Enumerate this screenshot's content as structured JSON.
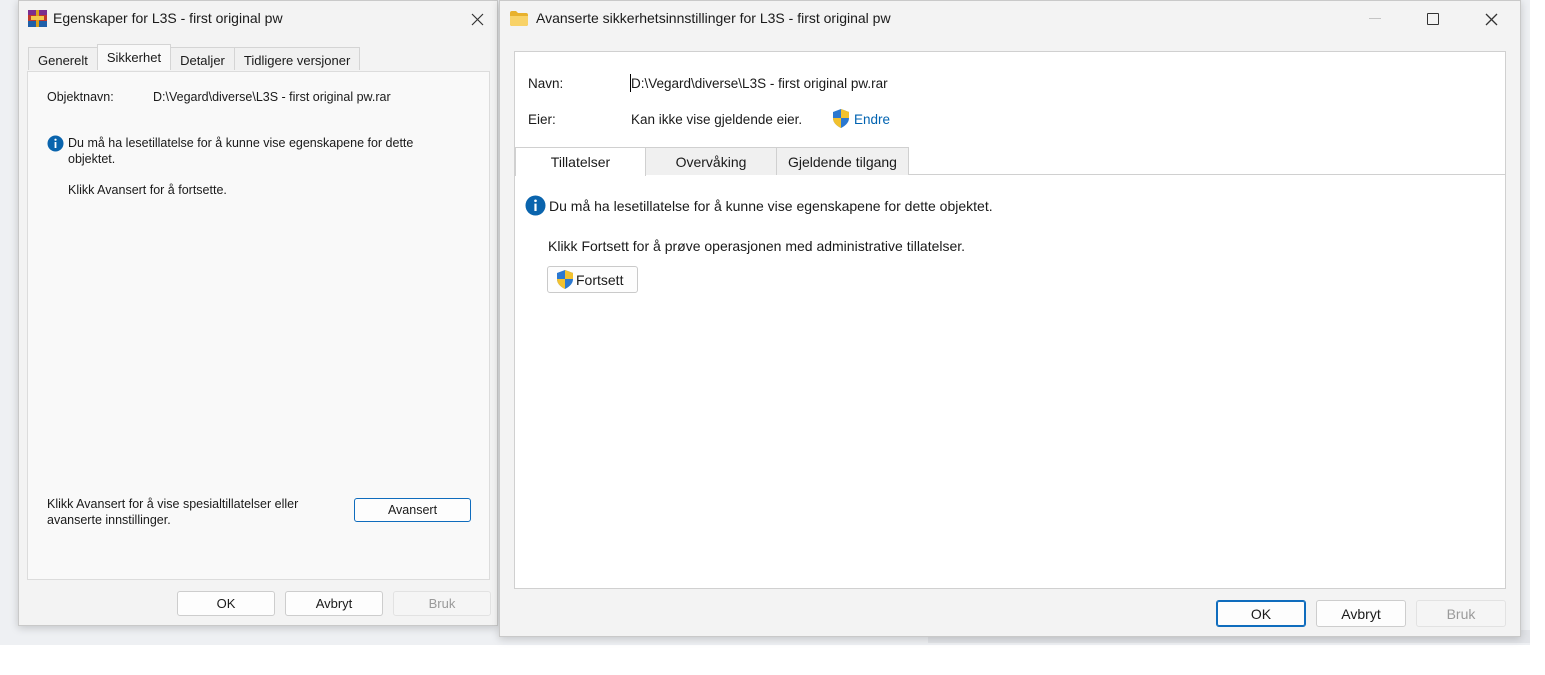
{
  "left_window": {
    "title": "Egenskaper for L3S - first original pw",
    "app_icon": "winrar-icon",
    "tabs": [
      {
        "label": "Generelt",
        "active": false
      },
      {
        "label": "Sikkerhet",
        "active": true
      },
      {
        "label": "Detaljer",
        "active": false
      },
      {
        "label": "Tidligere versjoner",
        "active": false
      }
    ],
    "object_label": "Objektnavn:",
    "object_value": "D:\\Vegard\\diverse\\L3S - first original pw.rar",
    "info_message": "Du må ha lesetillatelse for å kunne vise egenskapene for dette objektet.",
    "click_hint": "Klikk Avansert for å fortsette.",
    "advanced_text": "Klikk Avansert for å vise spesialtillatelser eller avanserte innstillinger.",
    "advanced_button": "Avansert",
    "buttons": {
      "ok": "OK",
      "cancel": "Avbryt",
      "apply": "Bruk"
    }
  },
  "right_window": {
    "title": "Avanserte sikkerhetsinnstillinger for L3S - first original pw",
    "app_icon": "folder-icon",
    "name_label": "Navn:",
    "name_value": "D:\\Vegard\\diverse\\L3S - first original pw.rar",
    "owner_label": "Eier:",
    "owner_value": "Kan ikke vise gjeldende eier.",
    "change_link": "Endre",
    "tabs": [
      {
        "label": "Tillatelser",
        "active": true
      },
      {
        "label": "Overvåking",
        "active": false
      },
      {
        "label": "Gjeldende tilgang",
        "active": false
      }
    ],
    "info_message": "Du må ha lesetillatelse for å kunne vise egenskapene for dette objektet.",
    "click_hint": "Klikk Fortsett for å prøve operasjonen med administrative tillatelser.",
    "continue_button": "Fortsett",
    "buttons": {
      "ok": "OK",
      "cancel": "Avbryt",
      "apply": "Bruk"
    }
  },
  "colors": {
    "accent": "#0f6cbd",
    "link": "#0063b1",
    "info_icon": "#0a64ad",
    "disabled_text": "#9a9a9a"
  }
}
